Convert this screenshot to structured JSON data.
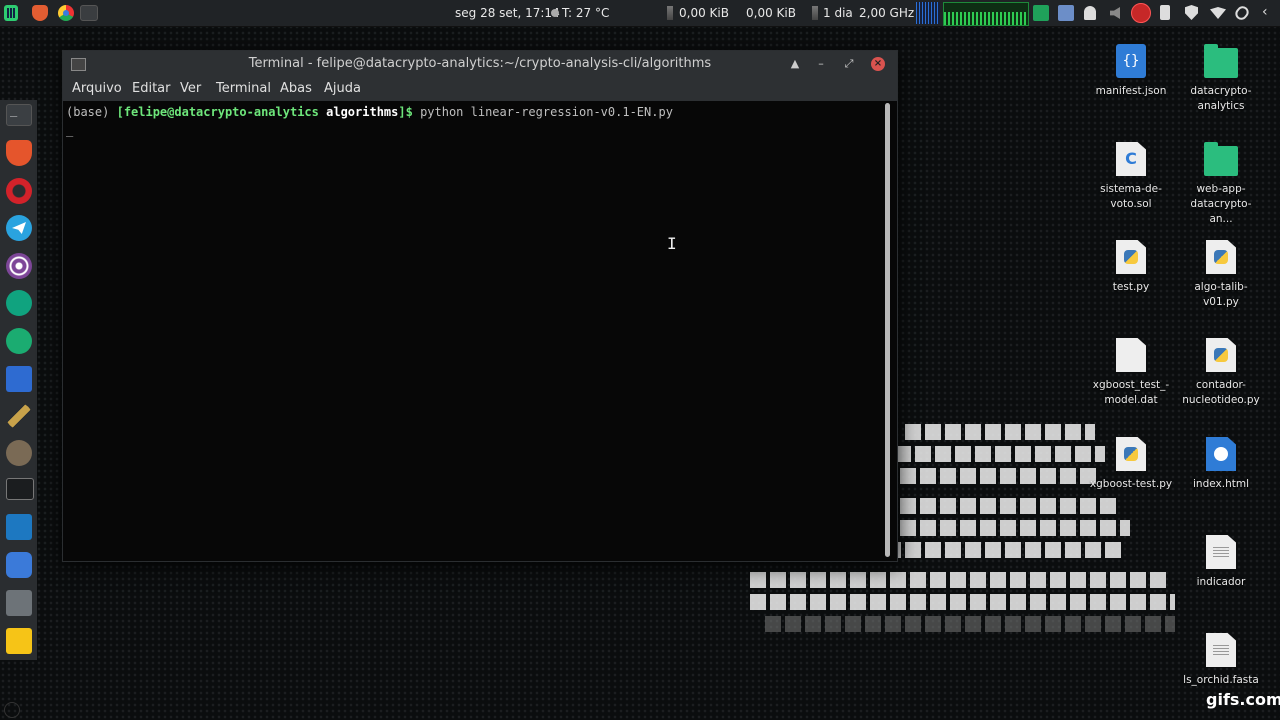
{
  "top_panel": {
    "clock": "seg 28 set, 17:14",
    "temperature": "T: 27 °C",
    "net_down": "0,00 KiB",
    "net_up": "0,00 KiB",
    "uptime": "1 dia",
    "cpu_freq": "2,00 GHz"
  },
  "terminal": {
    "title": "Terminal - felipe@datacrypto-analytics:~/crypto-analysis-cli/algorithms",
    "menu": [
      "Arquivo",
      "Editar",
      "Ver",
      "Terminal",
      "Abas",
      "Ajuda"
    ],
    "prompt_env": "(base) ",
    "prompt_open": "[",
    "prompt_user_host": "felipe@datacrypto-analytics",
    "prompt_dir": "algorithms",
    "prompt_close": "]$ ",
    "command": "python linear-regression-v0.1-EN.py",
    "cursor": "_"
  },
  "desktop_icons": [
    {
      "label": "manifest.json",
      "icon": "json-file-icon"
    },
    {
      "label": "datacrypto-analytics",
      "icon": "folder-icon"
    },
    {
      "label": "sistema-de-voto.sol",
      "icon": "c-file-icon"
    },
    {
      "label": "web-app-datacrypto-an...",
      "icon": "folder-icon"
    },
    {
      "label": "test.py",
      "icon": "python-file-icon"
    },
    {
      "label": "algo-talib-v01.py",
      "icon": "python-file-icon"
    },
    {
      "label": "xgboost_test_-model.dat",
      "icon": "blank-file-icon"
    },
    {
      "label": "contador-nucleotideo.py",
      "icon": "python-file-icon"
    },
    {
      "label": "xgboost-test.py",
      "icon": "python-file-icon"
    },
    {
      "label": "index.html",
      "icon": "html-file-icon"
    },
    {
      "label": "indicador",
      "icon": "text-file-icon"
    },
    {
      "label": "ls_orchid.fasta",
      "icon": "text-file-icon"
    }
  ],
  "watermark": "gifs.com"
}
